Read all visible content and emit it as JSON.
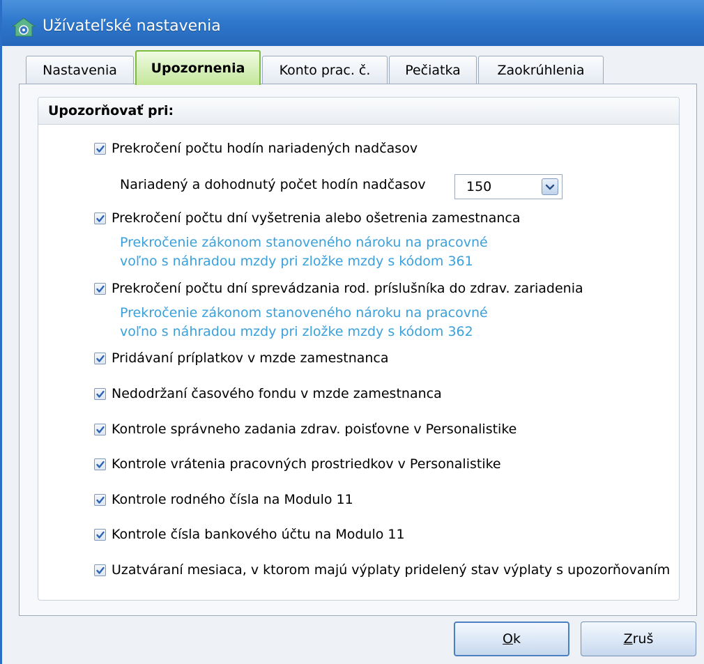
{
  "window": {
    "title": "Užívateľské nastavenia"
  },
  "tabs": [
    {
      "label": "Nastavenia",
      "active": false
    },
    {
      "label": "Upozornenia",
      "active": true
    },
    {
      "label": "Konto prac. č.",
      "active": false
    },
    {
      "label": "Pečiatka",
      "active": false
    },
    {
      "label": "Zaokrúhlenia",
      "active": false
    }
  ],
  "group": {
    "title": "Upozorňovať pri:",
    "options": [
      {
        "label": "Prekročení počtu hodín nariadených nadčasov",
        "checked": true
      },
      {
        "label": "Prekročení počtu dní vyšetrenia alebo ošetrenia zamestnanca",
        "checked": true
      },
      {
        "label": "Prekročení počtu dní sprevádzania rod. príslušníka do zdrav. zariadenia",
        "checked": true
      },
      {
        "label": "Pridávaní príplatkov v mzde zamestnanca",
        "checked": true
      },
      {
        "label": "Nedodržaní časového fondu v mzde zamestnanca",
        "checked": true
      },
      {
        "label": "Kontrole správneho zadania zdrav. poisťovne v Personalistike",
        "checked": true
      },
      {
        "label": "Kontrole vrátenia pracovných prostriedkov v Personalistike",
        "checked": true
      },
      {
        "label": "Kontrole rodného čísla na Modulo 11",
        "checked": true
      },
      {
        "label": "Kontrole čísla bankového účtu na Modulo 11",
        "checked": true
      },
      {
        "label": "Uzatváraní mesiaca, v ktorom majú výplaty pridelený stav výplaty s upozorňovaním",
        "checked": true
      }
    ],
    "overtime": {
      "label": "Nariadený a dohodnutý počet hodín nadčasov",
      "value": "150"
    },
    "note_361": {
      "line1": "Prekročenie zákonom stanoveného nároku na pracovné",
      "line2": "voľno s náhradou mzdy pri zložke mzdy s kódom 361"
    },
    "note_362": {
      "line1": "Prekročenie zákonom stanoveného nároku na pracovné",
      "line2": "voľno s náhradou mzdy pri zložke mzdy s kódom 362"
    }
  },
  "buttons": {
    "ok": {
      "mnemonic": "O",
      "rest": "k"
    },
    "cancel": {
      "mnemonic": "Z",
      "rest": "ruš"
    }
  },
  "colors": {
    "titlebar": "#2f78cc",
    "active_tab": "#c3e69a",
    "note_text": "#3aa0dc",
    "checkmark": "#2a62b8"
  }
}
